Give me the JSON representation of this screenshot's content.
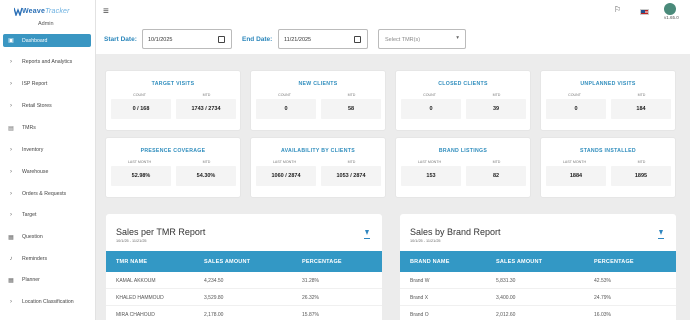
{
  "app": {
    "logo_bold": "Weave",
    "logo_light": "Tracker",
    "role": "Admin",
    "version": "v1.65.0"
  },
  "sidebar": {
    "items": [
      {
        "label": "Dashboard",
        "icon": "dashboard-icon",
        "active": true
      },
      {
        "label": "Reports and Analytics",
        "icon": "chevron-right-icon"
      },
      {
        "label": "ISP Report",
        "icon": "chevron-right-icon"
      },
      {
        "label": "Retail Stores",
        "icon": "chevron-right-icon"
      },
      {
        "label": "TMRs",
        "icon": "bus-icon"
      },
      {
        "label": "Inventory",
        "icon": "chevron-right-icon"
      },
      {
        "label": "Warehouse",
        "icon": "chevron-right-icon"
      },
      {
        "label": "Orders & Requests",
        "icon": "chevron-right-icon"
      },
      {
        "label": "Target",
        "icon": "chevron-right-icon"
      },
      {
        "label": "Question",
        "icon": "calendar-icon"
      },
      {
        "label": "Reminders",
        "icon": "bell-icon"
      },
      {
        "label": "Planner",
        "icon": "calendar-icon"
      },
      {
        "label": "Location Classification",
        "icon": "chevron-right-icon"
      }
    ]
  },
  "filters": {
    "start_label": "Start Date:",
    "start_value": "10/1/2025",
    "end_label": "End Date:",
    "end_value": "11/21/2025",
    "tmr_placeholder": "Select TMR(s)"
  },
  "cards": [
    {
      "title": "TARGET VISITS",
      "left_sub": "COUNT",
      "right_sub": "MTD",
      "left": "0 / 168",
      "right": "1743 / 2734"
    },
    {
      "title": "NEW CLIENTS",
      "left_sub": "COUNT",
      "right_sub": "MTD",
      "left": "0",
      "right": "58"
    },
    {
      "title": "CLOSED CLIENTS",
      "left_sub": "COUNT",
      "right_sub": "MTD",
      "left": "0",
      "right": "39"
    },
    {
      "title": "UNPLANNED VISITS",
      "left_sub": "COUNT",
      "right_sub": "MTD",
      "left": "0",
      "right": "184"
    },
    {
      "title": "PRESENCE COVERAGE",
      "left_sub": "LAST MONTH",
      "right_sub": "MTD",
      "left": "52.98%",
      "right": "54.30%"
    },
    {
      "title": "AVAILABILITY BY CLIENTS",
      "left_sub": "LAST MONTH",
      "right_sub": "MTD",
      "left": "1060 / 2874",
      "right": "1053 / 2874"
    },
    {
      "title": "BRAND LISTINGS",
      "left_sub": "LAST MONTH",
      "right_sub": "MTD",
      "left": "153",
      "right": "82"
    },
    {
      "title": "STANDS INSTALLED",
      "left_sub": "LAST MONTH",
      "right_sub": "MTD",
      "left": "1884",
      "right": "1895"
    }
  ],
  "tmr_report": {
    "title": "Sales per TMR Report",
    "date_range": "10/1/25 - 11/21/25",
    "headers": [
      "TMR NAME",
      "SALES AMOUNT",
      "PERCENTAGE"
    ],
    "rows": [
      [
        "KAMAL AKKOUM",
        "4,234.50",
        "31.28%"
      ],
      [
        "KHALED HAMMOUD",
        "3,529.80",
        "26.32%"
      ],
      [
        "MIRA CHAHOUD",
        "2,178.00",
        "15.87%"
      ]
    ]
  },
  "brand_report": {
    "title": "Sales by Brand Report",
    "date_range": "10/1/25 - 11/21/25",
    "headers": [
      "BRAND NAME",
      "SALES AMOUNT",
      "PERCENTAGE"
    ],
    "rows": [
      [
        "Brand W",
        "5,831.30",
        "42.53%"
      ],
      [
        "Brand X",
        "3,400.00",
        "24.79%"
      ],
      [
        "Brand O",
        "2,012.60",
        "16.03%"
      ]
    ]
  }
}
